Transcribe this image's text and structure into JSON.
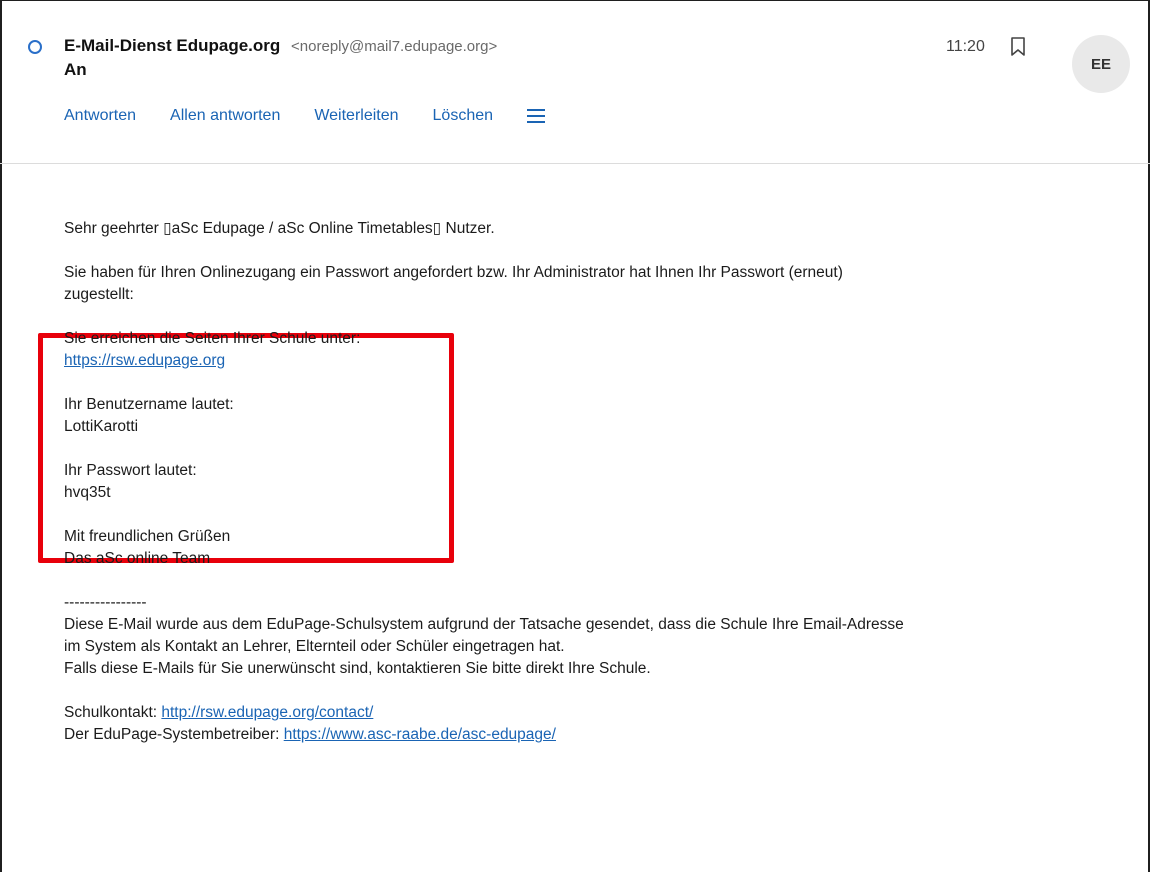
{
  "header": {
    "sender_name": "E-Mail-Dienst Edupage.org",
    "sender_address": "<noreply@mail7.edupage.org>",
    "to_label": "An",
    "time": "11:20",
    "avatar_initials": "EE"
  },
  "actions": {
    "reply": "Antworten",
    "reply_all": "Allen antworten",
    "forward": "Weiterleiten",
    "delete": "Löschen"
  },
  "message": {
    "greeting": "Sehr geehrter ▯aSc Edupage / aSc Online Timetables▯ Nutzer.",
    "intro_line1": "Sie haben für Ihren Onlinezugang ein Passwort angefordert bzw. Ihr Administrator hat Ihnen Ihr Passwort (erneut)",
    "intro_line2": "zugestellt:",
    "school_label": "Sie erreichen die Seiten Ihrer Schule unter:",
    "school_url": "https://rsw.edupage.org",
    "username_label": "Ihr Benutzername lautet:",
    "username": "LottiKarotti",
    "password_label": "Ihr Passwort lautet:",
    "password": "hvq35t",
    "closing_line1": "Mit freundlichen Grüßen",
    "closing_line2": "Das aSc online Team",
    "separator": "----------------",
    "footer_line1": "Diese E-Mail wurde aus dem EduPage-Schulsystem aufgrund der Tatsache gesendet, dass die Schule Ihre Email-Adresse",
    "footer_line2": "im System als Kontakt an Lehrer, Elternteil oder Schüler eingetragen hat.",
    "footer_line3": "Falls diese E-Mails für Sie unerwünscht sind, kontaktieren Sie bitte direkt Ihre Schule.",
    "contact_label": "Schulkontakt:",
    "contact_url": "http://rsw.edupage.org/contact/",
    "operator_label": "Der EduPage-Systembetreiber:",
    "operator_url": "https://www.asc-raabe.de/asc-edupage/"
  },
  "colors": {
    "link": "#1a64b4",
    "highlight_border": "#e8000b",
    "unread_indicator": "#2a6fc9"
  }
}
